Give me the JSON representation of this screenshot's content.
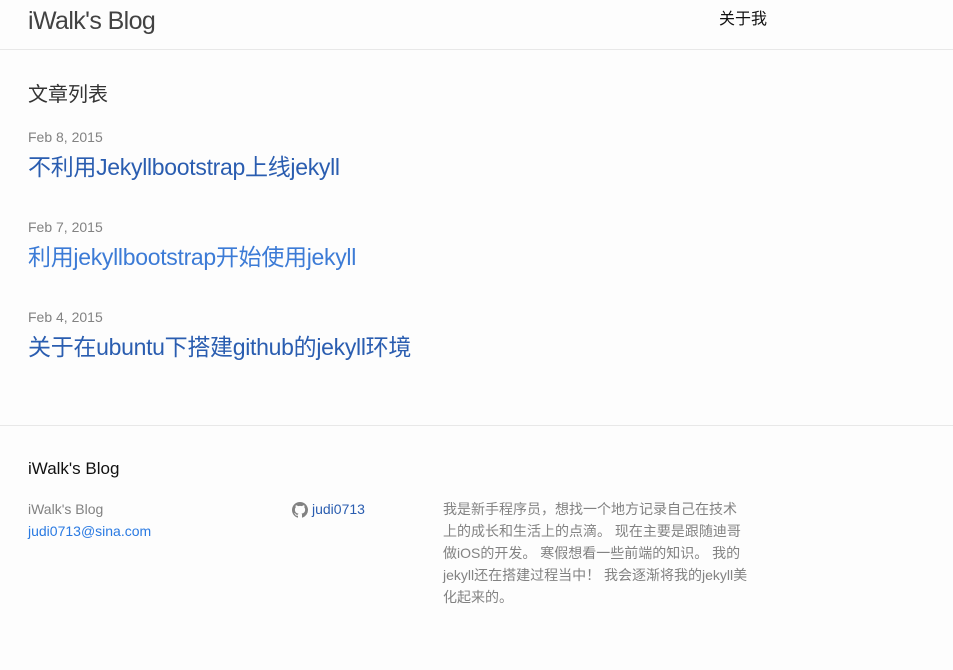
{
  "header": {
    "site_title": "iWalk's Blog",
    "nav": [
      {
        "label": "关于我"
      }
    ]
  },
  "main": {
    "heading": "文章列表",
    "posts": [
      {
        "date": "Feb 8, 2015",
        "title": "不利用Jekyllbootstrap上线jekyll"
      },
      {
        "date": "Feb 7, 2015",
        "title": "利用jekyllbootstrap开始使用jekyll"
      },
      {
        "date": "Feb 4, 2015",
        "title": "关于在ubuntu下搭建github的jekyll环境"
      }
    ]
  },
  "footer": {
    "heading": "iWalk's Blog",
    "name": "iWalk's Blog",
    "email": "judi0713@sina.com",
    "github": {
      "icon": "github-icon",
      "username": "judi0713"
    },
    "description": "我是新手程序员，想找一个地方记录自己在技术\n上的成长和生活上的点滴。 现在主要是跟随迪哥\n做iOS的开发。 寒假想看一些前端的知识。 我的\njekyll还在搭建过程当中！ 我会逐渐将我的jekyll美\n化起来的。"
  },
  "colors": {
    "link": "#2a5db0",
    "link_hover": "#3c7bd6",
    "meta": "#828282",
    "border": "#e8e8e8",
    "background": "#fdfdfd"
  }
}
